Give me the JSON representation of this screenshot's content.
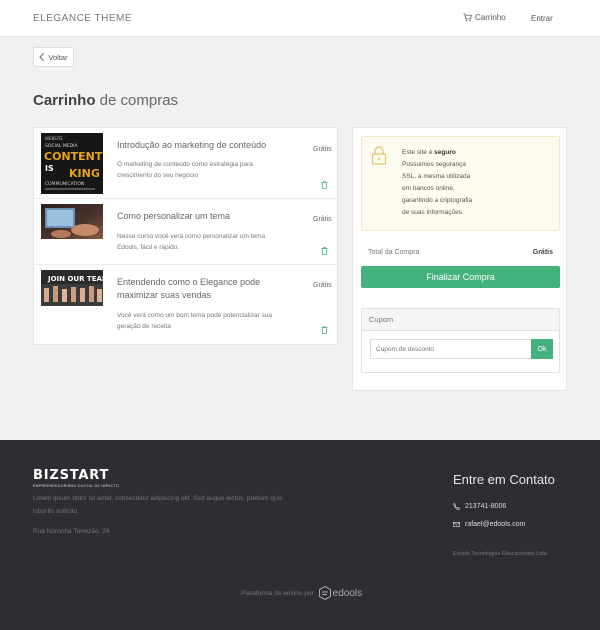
{
  "header": {
    "brand": "ELEGANCE THEME",
    "cart": "Carrinho",
    "login": "Entrar"
  },
  "back_button": "Voltar",
  "page_title": {
    "bold": "Carrinho",
    "rest": " de compras"
  },
  "cart_items": [
    {
      "title": "Introdução ao marketing de conteúdo",
      "description": "O marketing de conteúdo como estratégia para crescimento do seu negócio",
      "price": "Grátis",
      "thumb_words": [
        "WEBSITE",
        "SOCIAL MEDIA",
        "CONTENT",
        "IS",
        "KING",
        "COMMUNICATION"
      ]
    },
    {
      "title": "Como personalizar um tema",
      "description": "Nesse curso você verá como personalizar um tema Edools, fácil e rápido.",
      "price": "Grátis"
    },
    {
      "title": "Entendendo como o Elegance pode maximizar suas vendas",
      "description": "Você verá como um bom tema pode potencializar sua geração de receita",
      "price": "Grátis",
      "thumb_words": [
        "JOIN OUR TEAM"
      ]
    }
  ],
  "ssl": {
    "line1_pre": "Este site é ",
    "line1_bold": "seguro",
    "rest": "Possuimos segurança SSL, a mesma utilizada em bancos online, garantindo a criptografia de suas informações."
  },
  "total": {
    "label": "Total da Compra",
    "value": "Grátis"
  },
  "checkout_button": "Finalizar Compra",
  "coupon": {
    "title": "Cupom",
    "placeholder": "Cupom de desconto",
    "ok_button": "Ok"
  },
  "footer": {
    "logo_main": "BIZSTART",
    "logo_sub": "EMPREENDEDORISMO DIGITAL DE IMPACTO",
    "text": "Lorem ipsum dolor sit amet, consectetur adipiscing elit. Sed augue lectus, pretium quis lobortis sollicitu",
    "address": "Rua Noronha Torrezão, 24",
    "contact_title": "Entre em Contato",
    "phone": "213741-8006",
    "email": "rafael@edools.com",
    "company": "Edools Tecnologias Educacionais Ltda",
    "platform_label": "Plataforma de ensino por",
    "platform_brand": "edools"
  },
  "colors": {
    "accent": "#44b27d",
    "footer_bg": "#2c2e31",
    "ssl_bg": "#fdfaef"
  }
}
